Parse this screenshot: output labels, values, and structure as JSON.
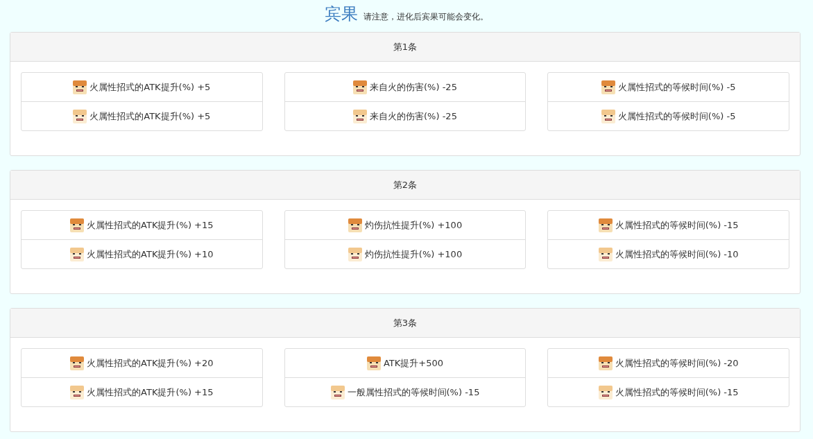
{
  "header": {
    "title": "宾果",
    "note": "请注意，进化后宾果可能会变化。"
  },
  "panels": [
    {
      "title": "第1条",
      "groups": [
        [
          {
            "kind": "base",
            "text": "火属性招式的ATK提升(%) +5"
          },
          {
            "kind": "evolved",
            "text": "火属性招式的ATK提升(%) +5"
          }
        ],
        [
          {
            "kind": "base",
            "text": "来自火的伤害(%) -25"
          },
          {
            "kind": "evolved",
            "text": "来自火的伤害(%) -25"
          }
        ],
        [
          {
            "kind": "base",
            "text": "火属性招式的等候时间(%) -5"
          },
          {
            "kind": "evolved",
            "text": "火属性招式的等候时间(%) -5"
          }
        ]
      ]
    },
    {
      "title": "第2条",
      "groups": [
        [
          {
            "kind": "base",
            "text": "火属性招式的ATK提升(%) +15"
          },
          {
            "kind": "evolved",
            "text": "火属性招式的ATK提升(%) +10"
          }
        ],
        [
          {
            "kind": "base",
            "text": "灼伤抗性提升(%) +100"
          },
          {
            "kind": "evolved",
            "text": "灼伤抗性提升(%) +100"
          }
        ],
        [
          {
            "kind": "base",
            "text": "火属性招式的等候时间(%) -15"
          },
          {
            "kind": "evolved",
            "text": "火属性招式的等候时间(%) -10"
          }
        ]
      ]
    },
    {
      "title": "第3条",
      "groups": [
        [
          {
            "kind": "base",
            "text": "火属性招式的ATK提升(%) +20"
          },
          {
            "kind": "evolved",
            "text": "火属性招式的ATK提升(%) +15"
          }
        ],
        [
          {
            "kind": "base",
            "text": "ATK提升+500"
          },
          {
            "kind": "evolved",
            "text": "一般属性招式的等候时间(%) -15"
          }
        ],
        [
          {
            "kind": "base",
            "text": "火属性招式的等候时间(%) -20"
          },
          {
            "kind": "evolved",
            "text": "火属性招式的等候时间(%) -15"
          }
        ]
      ]
    }
  ]
}
